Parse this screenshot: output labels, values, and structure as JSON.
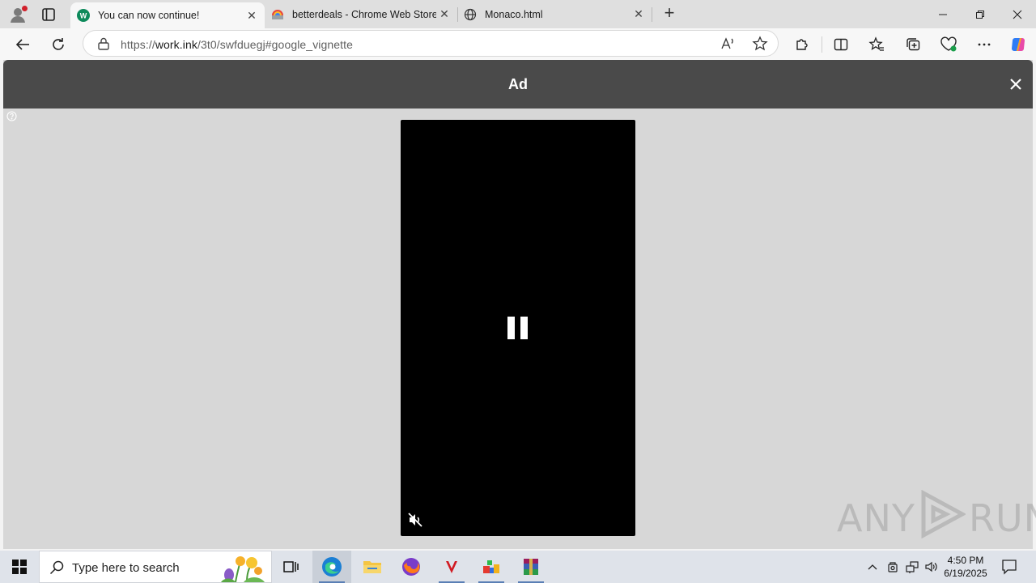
{
  "browser": {
    "tabs": [
      {
        "title": "You can now continue!",
        "active": true
      },
      {
        "title": "betterdeals - Chrome Web Store",
        "active": false
      },
      {
        "title": "Monaco.html",
        "active": false
      }
    ],
    "address_bar": {
      "url_prefix": "https://",
      "url_host": "work.ink",
      "url_path": "/3t0/swfduegj#google_vignette"
    }
  },
  "page": {
    "ad_label": "Ad"
  },
  "watermark": {
    "left": "ANY",
    "right": "RUN"
  },
  "taskbar": {
    "search_placeholder": "Type here to search",
    "time": "4:50 PM",
    "date": "6/19/2025"
  },
  "colors": {
    "ad_bar": "#4a4a4a",
    "page_bg": "#d7d7d7",
    "video_bg": "#000000",
    "taskbar": "#dfe3ea"
  }
}
